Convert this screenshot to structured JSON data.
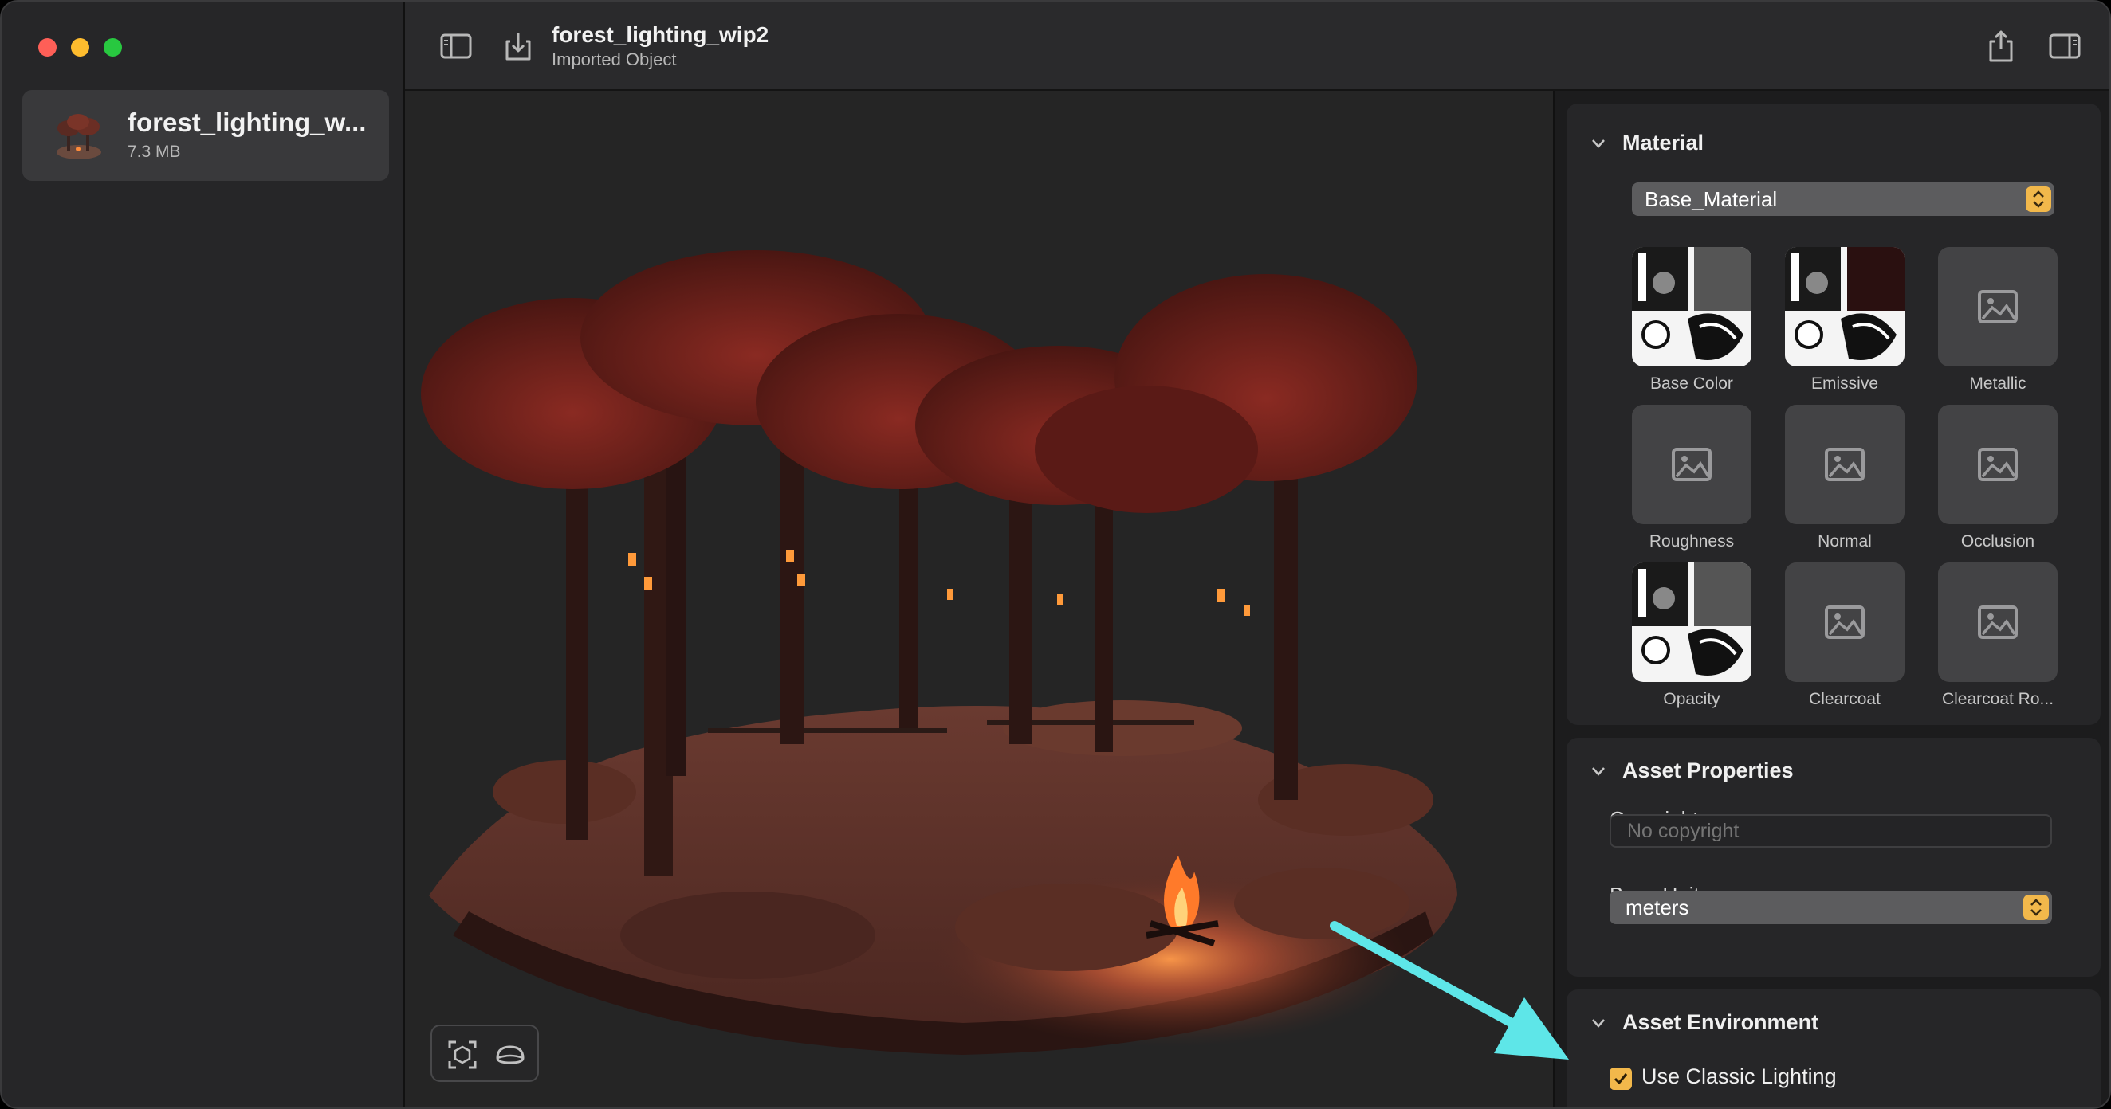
{
  "window": {
    "title": "forest_lighting_wip2",
    "subtitle": "Imported Object"
  },
  "sidebar": {
    "items": [
      {
        "name": "forest_lighting_w...",
        "size": "7.3 MB"
      }
    ]
  },
  "toolbar": {
    "icons": [
      "sidebar-toggle-icon",
      "import-icon",
      "share-icon",
      "inspector-toggle-icon"
    ]
  },
  "viewport": {
    "controls": [
      "frame-object-icon",
      "environment-icon"
    ]
  },
  "inspector": {
    "material": {
      "header": "Material",
      "selected": "Base_Material",
      "textures": [
        {
          "label": "Base Color",
          "has_image": true
        },
        {
          "label": "Emissive",
          "has_image": true
        },
        {
          "label": "Metallic",
          "has_image": false
        },
        {
          "label": "Roughness",
          "has_image": false
        },
        {
          "label": "Normal",
          "has_image": false
        },
        {
          "label": "Occlusion",
          "has_image": false
        },
        {
          "label": "Opacity",
          "has_image": true
        },
        {
          "label": "Clearcoat",
          "has_image": false
        },
        {
          "label": "Clearcoat Ro...",
          "has_image": false
        }
      ]
    },
    "asset_properties": {
      "header": "Asset Properties",
      "copyright_label": "Copyright",
      "copyright_placeholder": "No copyright",
      "units_label": "Base Units",
      "units_value": "meters"
    },
    "asset_environment": {
      "header": "Asset Environment",
      "classic_lighting_label": "Use Classic Lighting",
      "classic_lighting_checked": true
    }
  },
  "colors": {
    "accent": "#f2b84b",
    "annotation_arrow": "#5ee6e8"
  }
}
